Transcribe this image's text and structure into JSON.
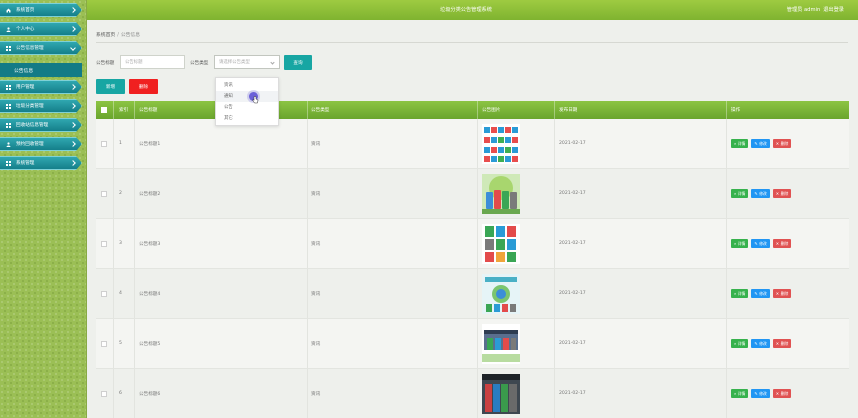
{
  "header": {
    "title": "垃圾分类公告管理系统",
    "user_label": "管理员 admin",
    "logout": "退出登录"
  },
  "sidebar": {
    "items": [
      {
        "label": "系统首页",
        "icon": "home-icon"
      },
      {
        "label": "个人中心",
        "icon": "user-icon"
      },
      {
        "label": "公告信息管理",
        "icon": "grid-icon"
      },
      {
        "label": "用户管理",
        "icon": "grid-icon"
      },
      {
        "label": "垃圾分类管理",
        "icon": "grid-icon"
      },
      {
        "label": "回收站信息管理",
        "icon": "grid-icon"
      },
      {
        "label": "预约回收管理",
        "icon": "user-icon"
      },
      {
        "label": "系统管理",
        "icon": "grid-icon"
      }
    ],
    "sub_item": "公告信息"
  },
  "breadcrumb": {
    "home": "系统首页",
    "separator": "/",
    "current": "公告信息"
  },
  "search": {
    "title_label": "公告标题",
    "title_placeholder": "公告标题",
    "type_label": "公告类型",
    "type_placeholder": "请选择公告类型",
    "query_button": "查询"
  },
  "dropdown": {
    "options": [
      "资讯",
      "通知",
      "公告",
      "其它"
    ],
    "hovered_index": 1
  },
  "toolbar": {
    "add": "新增",
    "delete": "删除"
  },
  "table": {
    "headers": [
      "索引",
      "公告标题",
      "公告类型",
      "公告图片",
      "发布日期",
      "操作"
    ],
    "rows": [
      {
        "index": "1",
        "title": "公告标题1",
        "type": "资讯",
        "date": "2021-02-17"
      },
      {
        "index": "2",
        "title": "公告标题2",
        "type": "资讯",
        "date": "2021-02-17"
      },
      {
        "index": "3",
        "title": "公告标题3",
        "type": "资讯",
        "date": "2021-02-17"
      },
      {
        "index": "4",
        "title": "公告标题4",
        "type": "资讯",
        "date": "2021-02-17"
      },
      {
        "index": "5",
        "title": "公告标题5",
        "type": "资讯",
        "date": "2021-02-17"
      },
      {
        "index": "6",
        "title": "公告标题6",
        "type": "资讯",
        "date": "2021-02-17"
      }
    ],
    "actions": {
      "detail": "详情",
      "edit": "修改",
      "delete": "删除"
    }
  },
  "colors": {
    "header_green": "#8cc443",
    "menu_teal": "#1a8f98",
    "detail_green": "#37b24d",
    "edit_blue": "#2196f3",
    "delete_red": "#e05252"
  }
}
